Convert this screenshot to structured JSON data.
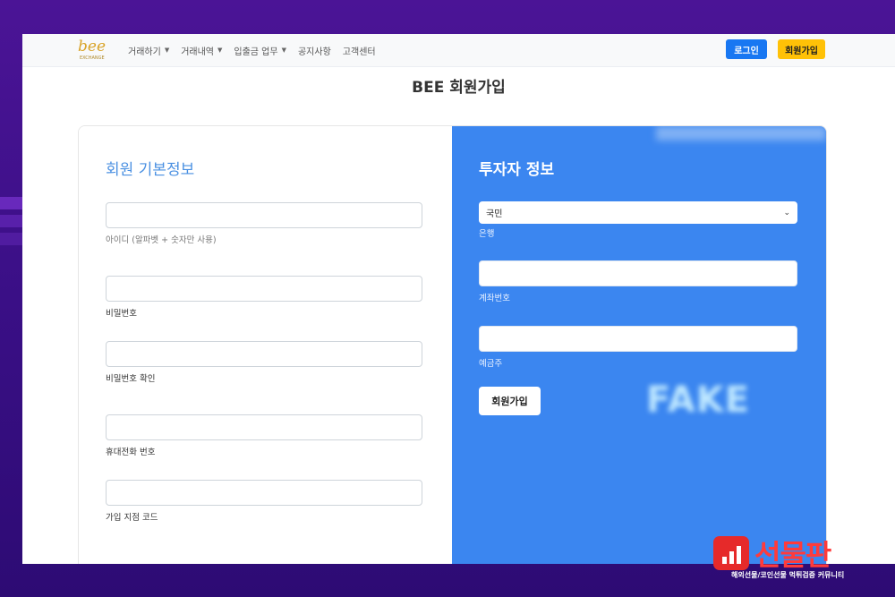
{
  "navbar": {
    "logo_text": "bee",
    "logo_sub": "EXCHANGE",
    "menu": [
      {
        "label": "거래하기",
        "has_dropdown": true
      },
      {
        "label": "거래내역",
        "has_dropdown": true
      },
      {
        "label": "입출금 업무",
        "has_dropdown": true
      },
      {
        "label": "공지사항",
        "has_dropdown": false
      },
      {
        "label": "고객센터",
        "has_dropdown": false
      }
    ],
    "login_label": "로그인",
    "signup_label": "회원가입"
  },
  "page": {
    "title": "BEE 회원가입"
  },
  "basic_info": {
    "title": "회원 기본정보",
    "fields": [
      {
        "label": "아이디 (알파벳 + 숫자만 사용)",
        "value": ""
      },
      {
        "label": "비밀번호",
        "value": ""
      },
      {
        "label": "비밀번호 확인",
        "value": ""
      },
      {
        "label": "휴대전화 번호",
        "value": ""
      },
      {
        "label": "가입 지점 코드",
        "value": ""
      }
    ]
  },
  "investor_info": {
    "title": "투자자 정보",
    "bank_select": {
      "value": "국민",
      "label": "은행"
    },
    "fields": [
      {
        "label": "계좌번호",
        "value": ""
      },
      {
        "label": "예금주",
        "value": ""
      }
    ],
    "submit_label": "회원가입",
    "stamp_text": "FAKE"
  },
  "watermark": {
    "title": "선물판",
    "subtitle": "해외선물/코인선물 먹튀검증 커뮤니티"
  },
  "colors": {
    "background": "#3a0f86",
    "accent_blue": "#3b86f0",
    "login_button": "#1877f2",
    "signup_button": "#ffc107",
    "section_title": "#4a90e2",
    "watermark_red": "#e62a2a"
  }
}
